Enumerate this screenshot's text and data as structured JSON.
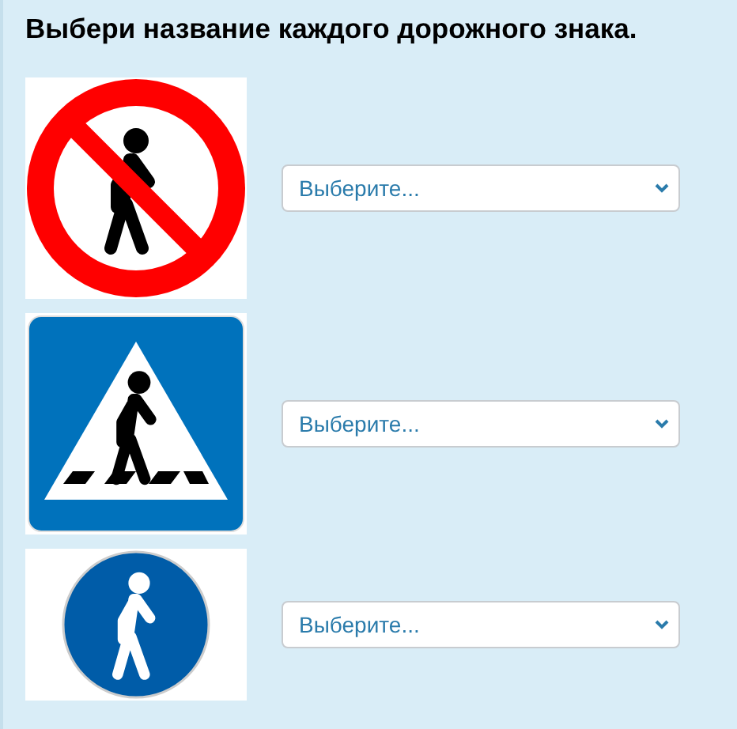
{
  "title": "Выбери название каждого дорожного знака.",
  "questions": [
    {
      "sign": {
        "kind": "no-pedestrians"
      },
      "select": {
        "placeholder": "Выберите..."
      }
    },
    {
      "sign": {
        "kind": "crosswalk"
      },
      "select": {
        "placeholder": "Выберите..."
      }
    },
    {
      "sign": {
        "kind": "footpath"
      },
      "select": {
        "placeholder": "Выберите..."
      }
    }
  ]
}
